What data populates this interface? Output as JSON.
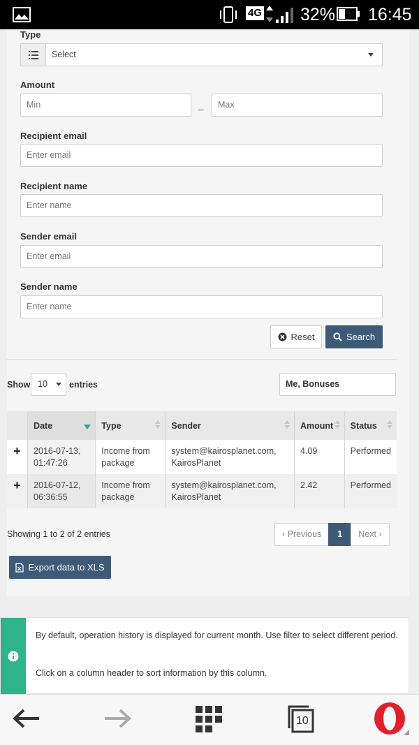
{
  "status_bar": {
    "network": "4G",
    "battery": "32%",
    "time": "16:45",
    "icons": [
      "image-icon",
      "vibrate-icon",
      "signal-icon",
      "battery-icon"
    ]
  },
  "filters": {
    "type_label": "Type",
    "type_select": "Select",
    "amount_label": "Amount",
    "amount_min_placeholder": "Min",
    "amount_max_placeholder": "Max",
    "amount_separator": "–",
    "recipient_email_label": "Recipient email",
    "recipient_email_placeholder": "Enter email",
    "recipient_name_label": "Recipient name",
    "recipient_name_placeholder": "Enter name",
    "sender_email_label": "Sender email",
    "sender_email_placeholder": "Enter email",
    "sender_name_label": "Sender name",
    "sender_name_placeholder": "Enter name",
    "reset_label": "Reset",
    "search_label": "Search"
  },
  "table_controls": {
    "show_label": "Show",
    "length_value": "10",
    "entries_label": "entries",
    "filter_value": "Me, Bonuses"
  },
  "table": {
    "columns": [
      "",
      "Date",
      "Type",
      "Sender",
      "Amount",
      "Status"
    ],
    "sorted_column": "Date",
    "rows": [
      {
        "expand": "+",
        "date": "2016-07-13, 01:47:26",
        "type": "Income from package",
        "sender": "system@kairosplanet.com, KairosPlanet",
        "amount": "4.09",
        "status": "Performed"
      },
      {
        "expand": "+",
        "date": "2016-07-12, 06:36:55",
        "type": "Income from package",
        "sender": "system@kairosplanet.com, KairosPlanet",
        "amount": "2.42",
        "status": "Performed"
      }
    ]
  },
  "footer": {
    "info": "Showing 1 to 2 of 2 entries",
    "prev": "‹ Previous",
    "page": "1",
    "next": "Next ›",
    "export_label": "Export data to XLS"
  },
  "notice": {
    "line1": "By default, operation history is displayed for current month. Use filter to select different period.",
    "line2": "Click on a column header to sort information by this column."
  },
  "browser_nav": {
    "tabs_count": "10"
  },
  "colors": {
    "primary": "#3e5a76",
    "accent": "#2fb38a",
    "sort_arrow": "#2aa8a0",
    "opera_red": "#e0202a"
  }
}
